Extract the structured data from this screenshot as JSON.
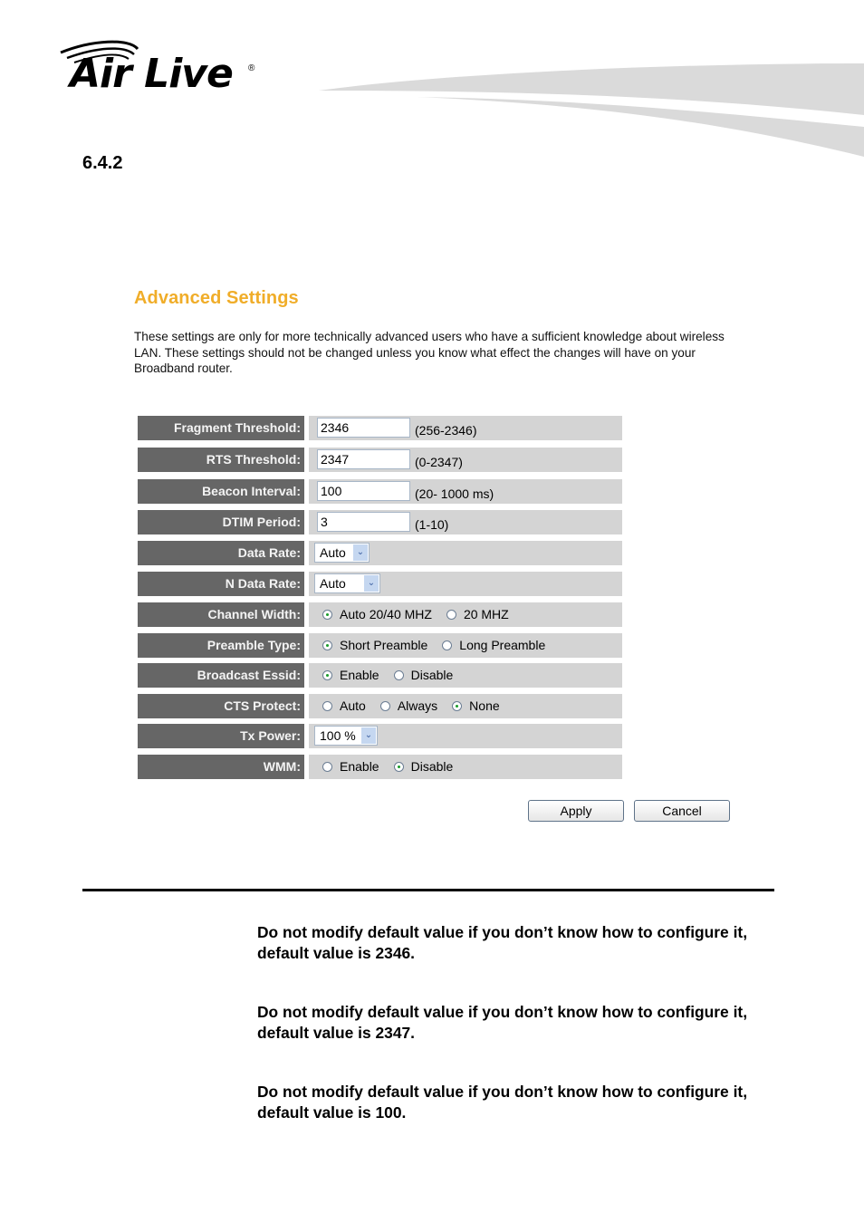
{
  "header": {
    "brand": "Air Live",
    "registered_mark": "®"
  },
  "section_number": "6.4.2",
  "panel": {
    "title": "Advanced Settings",
    "description": "These settings are only for more technically advanced users who have a sufficient knowledge about wireless LAN. These settings should not be changed unless you know what effect the changes will have on your Broadband router.",
    "fields": {
      "fragment_threshold": {
        "label": "Fragment Threshold:",
        "value": "2346",
        "hint": "(256-2346)"
      },
      "rts_threshold": {
        "label": "RTS Threshold:",
        "value": "2347",
        "hint": "(0-2347)"
      },
      "beacon_interval": {
        "label": "Beacon Interval:",
        "value": "100",
        "hint": "(20- 1000 ms)"
      },
      "dtim_period": {
        "label": "DTIM Period:",
        "value": "3",
        "hint": "(1-10)"
      },
      "data_rate": {
        "label": "Data Rate:",
        "selected": "Auto"
      },
      "n_data_rate": {
        "label": "N Data Rate:",
        "selected": "Auto"
      },
      "channel_width": {
        "label": "Channel Width:",
        "options": [
          "Auto 20/40 MHZ",
          "20 MHZ"
        ],
        "selected": "Auto 20/40 MHZ"
      },
      "preamble_type": {
        "label": "Preamble Type:",
        "options": [
          "Short Preamble",
          "Long Preamble"
        ],
        "selected": "Short Preamble"
      },
      "broadcast_essid": {
        "label": "Broadcast Essid:",
        "options": [
          "Enable",
          "Disable"
        ],
        "selected": "Enable"
      },
      "cts_protect": {
        "label": "CTS Protect:",
        "options": [
          "Auto",
          "Always",
          "None"
        ],
        "selected": "None"
      },
      "tx_power": {
        "label": "Tx Power:",
        "selected": "100 %"
      },
      "wmm": {
        "label": "WMM:",
        "options": [
          "Enable",
          "Disable"
        ],
        "selected": "Disable"
      }
    },
    "buttons": {
      "apply": "Apply",
      "cancel": "Cancel"
    }
  },
  "notes": [
    "Do not modify default value if you don’t know how to configure it, default value is 2346.",
    "Do not modify default value if you don’t know how to configure it, default value is 2347.",
    "Do not modify default value if you don’t know how to configure it, default value is 100."
  ],
  "colors": {
    "title_orange": "#f0ad29",
    "label_bg": "#666666",
    "value_bg": "#d4d4d4"
  }
}
